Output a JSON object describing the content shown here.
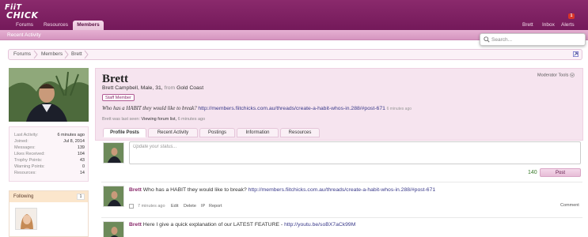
{
  "header": {
    "logo_line1": "FiiT",
    "logo_line2": "CHICK",
    "nav": [
      "Forums",
      "Resources",
      "Members"
    ],
    "active_nav": "Members",
    "right_links": [
      "Brett",
      "Inbox",
      "Alerts"
    ],
    "alerts_count": "1",
    "brand_color": "#7a1f5f"
  },
  "subbar": {
    "label": "Recent Activity"
  },
  "search": {
    "placeholder": "Search..."
  },
  "breadcrumb": [
    "Forums",
    "Members",
    "Brett"
  ],
  "sidebar": {
    "stats": [
      {
        "label": "Last Activity:",
        "value": "6 minutes ago"
      },
      {
        "label": "Joined:",
        "value": "Jul 8, 2014"
      },
      {
        "label": "Messages:",
        "value": "139"
      },
      {
        "label": "Likes Received:",
        "value": "104"
      },
      {
        "label": "Trophy Points:",
        "value": "43"
      },
      {
        "label": "Warning Points:",
        "value": "0"
      },
      {
        "label": "Resources:",
        "value": "14"
      }
    ],
    "following_label": "Following",
    "following_count": "1"
  },
  "profile": {
    "username": "Brett",
    "blurb_main": "Brett Campbell, Male, 31,",
    "blurb_from": "from",
    "blurb_location": "Gold Coast",
    "badge": "Staff Member",
    "moderator_tools": "Moderator Tools",
    "status_text": "Who has a HABIT they would like to break?",
    "status_link": "http://members.fiitchicks.com.au/threads/create-a-habit-whos-in.288/#post-671",
    "status_ago": "6 minutes ago",
    "last_seen_prefix": "Brett was last seen:",
    "last_seen_activity": "Viewing forum list,",
    "last_seen_ago": "6 minutes ago"
  },
  "tabs": [
    "Profile Posts",
    "Recent Activity",
    "Postings",
    "Information",
    "Resources"
  ],
  "active_tab": "Profile Posts",
  "status_box": {
    "placeholder": "Update your status...",
    "char_count": "140",
    "post_label": "Post"
  },
  "posts": [
    {
      "author": "Brett",
      "text": "Who has a HABIT they would like to break?",
      "link": "http://members.fiitchicks.com.au/threads/create-a-habit-whos-in.288/#post-671",
      "time": "7 minutes ago",
      "actions": [
        "Edit",
        "Delete",
        "IP",
        "Report"
      ],
      "comment": "Comment"
    },
    {
      "author": "Brett",
      "text": "Here I give a quick explanation of our LATEST FEATURE -",
      "link": "http://youtu.be/soBX7aCk99M"
    }
  ]
}
